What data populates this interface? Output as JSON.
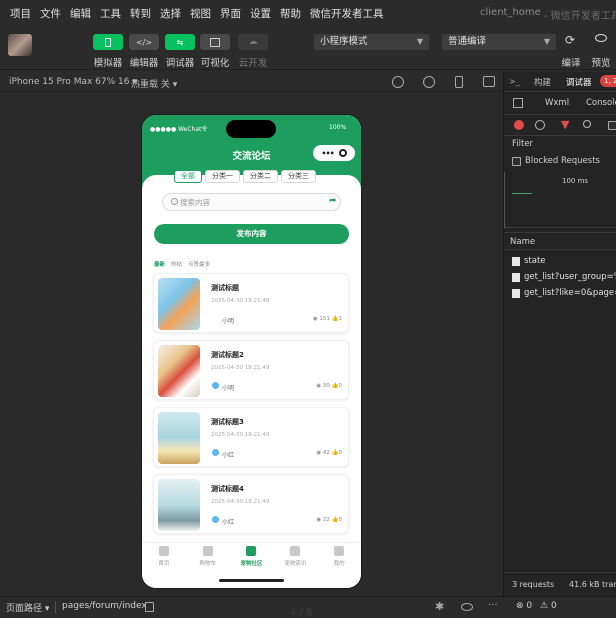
{
  "menubar": {
    "items": [
      "项目",
      "文件",
      "编辑",
      "工具",
      "转到",
      "选择",
      "视图",
      "界面",
      "设置",
      "帮助",
      "微信开发者工具"
    ],
    "window_title": "client_home",
    "window_sub": "- 微信开发者工具"
  },
  "toolbar": {
    "buttons": [
      {
        "label": "模拟器",
        "icon": "phone-icon",
        "active": true
      },
      {
        "label": "编辑器",
        "icon": "code-icon",
        "active": false
      },
      {
        "label": "调试器",
        "icon": "debug-icon",
        "active": true
      },
      {
        "label": "可视化",
        "icon": "layout-icon",
        "active": false
      },
      {
        "label": "云开发",
        "icon": "cloud-icon",
        "active": false
      }
    ],
    "mode_select": "小程序模式",
    "compile_select": "普通编译",
    "compile_label": "编译",
    "preview_label": "预览"
  },
  "simulator_bar": {
    "device": "iPhone 15 Pro Max 67% 16",
    "hot_reload": "热重载 关"
  },
  "phone": {
    "carrier": "●●●●● WeChat令",
    "battery": "100%",
    "nav_title": "交流论坛",
    "capsule_dots": "•••",
    "tabs": [
      {
        "label": "全部",
        "active": true
      },
      {
        "label": "分类一",
        "active": false
      },
      {
        "label": "分类二",
        "active": false
      },
      {
        "label": "分类三",
        "active": false
      }
    ],
    "search_placeholder": "搜索内容",
    "publish_label": "发布内容",
    "sort_tabs": [
      {
        "label": "最新",
        "active": true
      },
      {
        "label": "热帖",
        "active": false
      },
      {
        "label": "点赞最多",
        "active": false
      }
    ],
    "posts": [
      {
        "title": "测试标题",
        "date": "2025-04-30 18:21:48",
        "user": "小明",
        "views": "151",
        "likes": "1"
      },
      {
        "title": "测试标题2",
        "date": "2025-04-30 18:21:49",
        "user": "小明",
        "views": "30",
        "likes": "0"
      },
      {
        "title": "测试标题3",
        "date": "2025-04-30 18:21:49",
        "user": "小红",
        "views": "42",
        "likes": "0"
      },
      {
        "title": "测试标题4",
        "date": "2025-04-30 18:21:49",
        "user": "小红",
        "views": "22",
        "likes": "0"
      }
    ],
    "tabbar": [
      {
        "label": "首页",
        "active": false
      },
      {
        "label": "购物车",
        "active": false
      },
      {
        "label": "宠物社区",
        "active": true
      },
      {
        "label": "宠物资讯",
        "active": false
      },
      {
        "label": "我的",
        "active": false
      }
    ]
  },
  "devtools": {
    "tabs": [
      {
        "label": "构建",
        "active": false
      },
      {
        "label": "调试器",
        "active": true
      }
    ],
    "badge": "1, 2",
    "subtabs": [
      "Wxml",
      "Console"
    ],
    "filter_label": "Filter",
    "blocked_requests": "Blocked Requests",
    "timeline_tick": "100 ms",
    "name_header": "Name",
    "requests": [
      "state",
      "get_list?user_group=%E",
      "get_list?like=0&page=1"
    ],
    "footer_requests": "3 requests",
    "footer_transfer": "41.6 kB trans"
  },
  "statusbar": {
    "page_path_label": "页面路径",
    "page_path": "pages/forum/index",
    "errors": "0",
    "warnings": "0"
  },
  "page_indicator": "4 / 8",
  "colors": {
    "accent": "#1e9e5e",
    "toolbar_active": "#07c160",
    "error": "#d9433f"
  }
}
